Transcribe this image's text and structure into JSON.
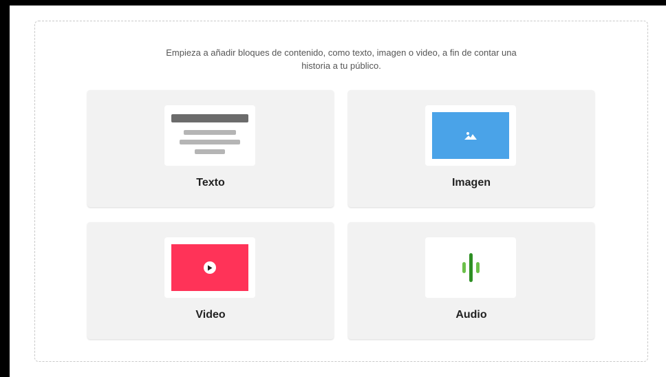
{
  "intro": {
    "line1": "Empieza a añadir bloques de contenido, como texto, imagen o video, a fin de contar una",
    "line2": "historia a tu público."
  },
  "blocks": [
    {
      "label": "Texto",
      "icon": "text-block-icon"
    },
    {
      "label": "Imagen",
      "icon": "image-block-icon",
      "color": "#4aa3e8"
    },
    {
      "label": "Video",
      "icon": "video-block-icon",
      "color": "#ff3358"
    },
    {
      "label": "Audio",
      "icon": "audio-block-icon",
      "color": "#4cae3a"
    }
  ]
}
